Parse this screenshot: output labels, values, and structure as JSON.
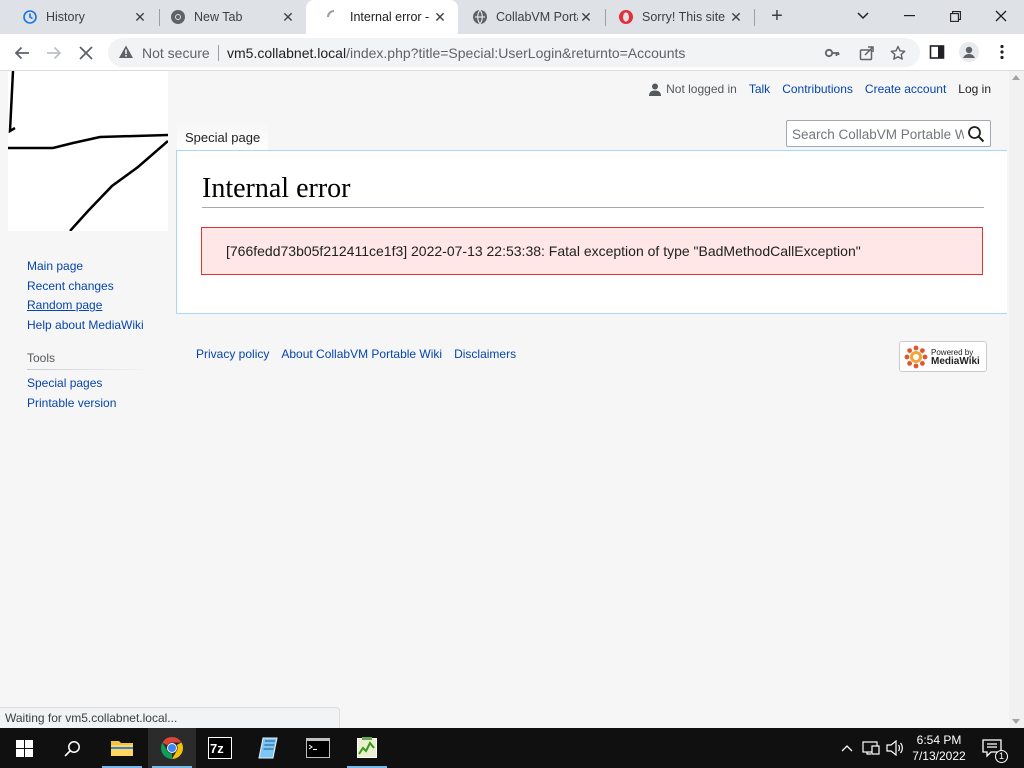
{
  "browser": {
    "tabs": [
      {
        "label": "History",
        "icon": "history-icon"
      },
      {
        "label": "New Tab",
        "icon": "chrome-icon"
      },
      {
        "label": "Internal error - C",
        "icon": "loading-icon",
        "active": true
      },
      {
        "label": "CollabVM Porta",
        "icon": "globe-icon"
      },
      {
        "label": "Sorry! This site",
        "icon": "opera-icon"
      }
    ],
    "security_label": "Not secure",
    "url_host": "vm5.collabnet.local",
    "url_path": "/index.php?title=Special:UserLogin&returnto=Accounts",
    "status_text": "Waiting for vm5.collabnet.local..."
  },
  "wiki": {
    "personal": {
      "user": "Not logged in",
      "talk": "Talk",
      "contributions": "Contributions",
      "create_account": "Create account",
      "login": "Log in"
    },
    "namespace_tab": "Special page",
    "search_placeholder": "Search CollabVM Portable W",
    "page_title": "Internal error",
    "error_message": "[766fedd73b05f212411ce1f3] 2022-07-13 22:53:38: Fatal exception of type \"BadMethodCallException\"",
    "navigation": [
      "Main page",
      "Recent changes",
      "Random page",
      "Help about MediaWiki"
    ],
    "tools_heading": "Tools",
    "tools": [
      "Special pages",
      "Printable version"
    ],
    "footer": [
      "Privacy policy",
      "About CollabVM Portable Wiki",
      "Disclaimers"
    ],
    "powered_by": {
      "line1": "Powered by",
      "line2": "MediaWiki"
    }
  },
  "taskbar": {
    "time": "6:54 PM",
    "date": "7/13/2022",
    "notification_count": "1"
  },
  "colors": {
    "link": "#0645ad",
    "error_bg": "#fee7e6",
    "error_border": "#dd3333",
    "tabstrip": "#dee1e6",
    "taskbar": "#101010"
  }
}
